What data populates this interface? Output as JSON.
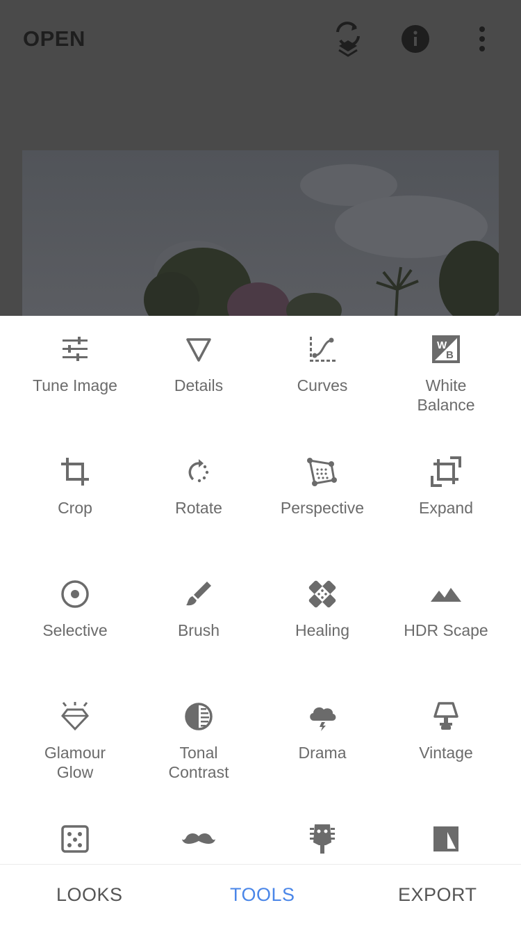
{
  "header": {
    "open_label": "OPEN",
    "icons": [
      "layers-undo-icon",
      "info-icon",
      "more-vert-icon"
    ]
  },
  "tools": [
    {
      "label": "Tune Image",
      "icon": "tune-sliders-icon"
    },
    {
      "label": "Details",
      "icon": "triangle-details-icon"
    },
    {
      "label": "Curves",
      "icon": "curves-icon"
    },
    {
      "label": "White\nBalance",
      "icon": "white-balance-icon"
    },
    {
      "label": "Crop",
      "icon": "crop-icon"
    },
    {
      "label": "Rotate",
      "icon": "rotate-icon"
    },
    {
      "label": "Perspective",
      "icon": "perspective-icon"
    },
    {
      "label": "Expand",
      "icon": "expand-icon"
    },
    {
      "label": "Selective",
      "icon": "selective-target-icon"
    },
    {
      "label": "Brush",
      "icon": "brush-icon"
    },
    {
      "label": "Healing",
      "icon": "healing-bandage-icon"
    },
    {
      "label": "HDR Scape",
      "icon": "mountains-icon"
    },
    {
      "label": "Glamour\nGlow",
      "icon": "diamond-glow-icon"
    },
    {
      "label": "Tonal\nContrast",
      "icon": "tonal-contrast-icon"
    },
    {
      "label": "Drama",
      "icon": "storm-cloud-icon"
    },
    {
      "label": "Vintage",
      "icon": "lamp-icon"
    },
    {
      "label": "",
      "icon": "grainy-dice-icon"
    },
    {
      "label": "",
      "icon": "mustache-icon"
    },
    {
      "label": "",
      "icon": "guitar-head-icon"
    },
    {
      "label": "",
      "icon": "split-square-icon"
    }
  ],
  "bottom_nav": {
    "looks": "LOOKS",
    "tools": "TOOLS",
    "export": "EXPORT",
    "active": "TOOLS"
  },
  "colors": {
    "accent": "#4a86e8",
    "icon": "#6b6b6b",
    "overlay": "#4a4a4a"
  }
}
